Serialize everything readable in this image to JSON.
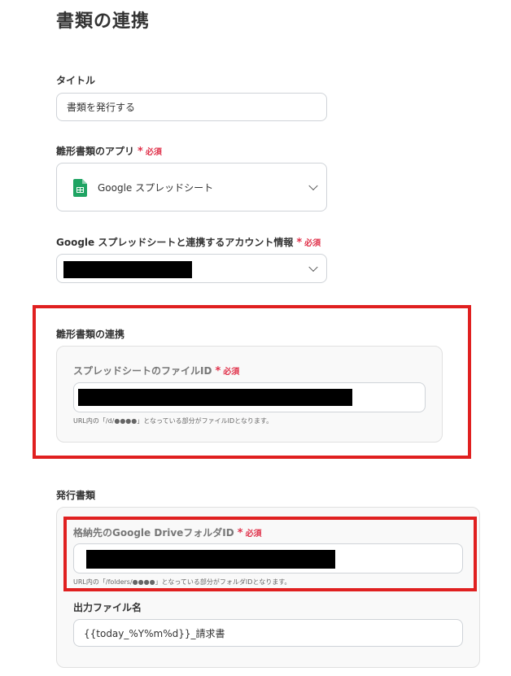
{
  "page": {
    "title": "書類の連携"
  },
  "title_field": {
    "label": "タイトル",
    "value": "書類を発行する"
  },
  "template_app": {
    "label": "雛形書類のアプリ",
    "required": "必須",
    "app_name": "Google スプレッドシート",
    "icon": "google-sheets-icon"
  },
  "account": {
    "label": "Google スプレッドシートと連携するアカウント情報",
    "required": "必須"
  },
  "template_link": {
    "section_label": "雛形書類の連携",
    "file_id_label": "スプレッドシートのファイルID",
    "required": "必須",
    "help": "URL内の「/d/●●●●」となっている部分がファイルIDとなります。"
  },
  "issue": {
    "section_label": "発行書類",
    "folder_label": "格納先のGoogle DriveフォルダID",
    "required": "必須",
    "folder_help": "URL内の「/folders/●●●●」となっている部分がフォルダIDとなります。",
    "output_label": "出力ファイル名",
    "output_value": "{{today_%Y%m%d}}_請求書"
  },
  "colors": {
    "required": "#e0314a",
    "highlight": "#e02020",
    "sheets_green": "#1fa463"
  }
}
